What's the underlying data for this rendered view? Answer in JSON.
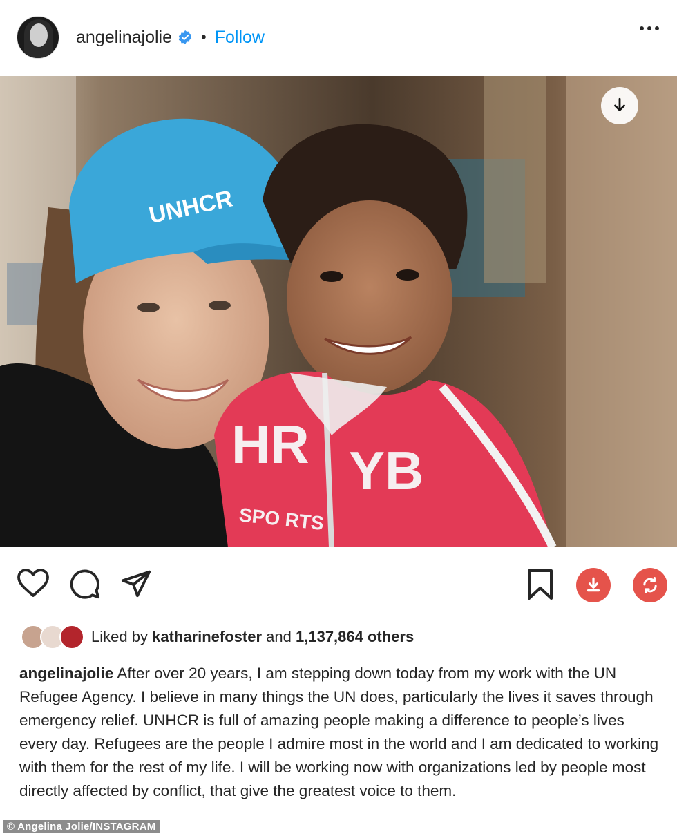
{
  "header": {
    "username": "angelinajolie",
    "separator": "•",
    "follow_label": "Follow"
  },
  "post": {
    "cap_text": "UNHCR",
    "shirt_text_left": "HR",
    "shirt_text_right": "YB",
    "shirt_text_small": "SPO RTS"
  },
  "likes": {
    "prefix": "Liked by",
    "user": "katharinefoster",
    "middle": "and",
    "count": "1,137,864 others"
  },
  "caption": {
    "username": "angelinajolie",
    "text": "After over 20 years, I am stepping down today from my work with the UN Refugee Agency.  I believe in many things the UN does, particularly the lives it saves through emergency relief. UNHCR is full of amazing people making a difference to people’s lives every day. Refugees are the people I admire most in the world and I am dedicated to working with them for the rest of my life. I will be working now with organizations led by people most directly affected by conflict, that give the greatest voice to them."
  },
  "credit": "© Angelina Jolie/INSTAGRAM",
  "colors": {
    "follow": "#0095f6",
    "accent_buttons": "#e5534b",
    "verified": "#3897f0"
  },
  "icons": [
    "more-options-icon",
    "verified-badge-icon",
    "download-icon",
    "heart-icon",
    "comment-icon",
    "share-icon",
    "bookmark-icon",
    "save-download-icon",
    "repost-icon"
  ]
}
